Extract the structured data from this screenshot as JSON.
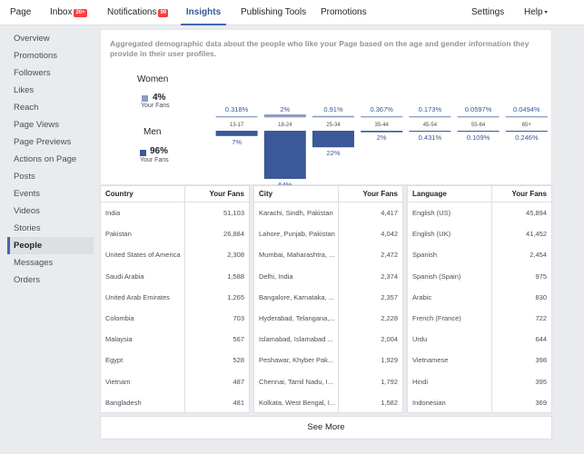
{
  "nav": {
    "items": [
      {
        "label": "Page"
      },
      {
        "label": "Inbox",
        "badge": "20+"
      },
      {
        "label": "Notifications",
        "badge": "99"
      },
      {
        "label": "Insights",
        "active": true
      },
      {
        "label": "Publishing Tools"
      },
      {
        "label": "Promotions"
      }
    ],
    "settings": "Settings",
    "help": "Help",
    "help_caret": "▾"
  },
  "sidebar": {
    "items": [
      {
        "label": "Overview"
      },
      {
        "label": "Promotions"
      },
      {
        "label": "Followers"
      },
      {
        "label": "Likes"
      },
      {
        "label": "Reach"
      },
      {
        "label": "Page Views"
      },
      {
        "label": "Page Previews"
      },
      {
        "label": "Actions on Page"
      },
      {
        "label": "Posts"
      },
      {
        "label": "Events"
      },
      {
        "label": "Videos"
      },
      {
        "label": "Stories"
      },
      {
        "label": "People",
        "active": true
      },
      {
        "label": "Messages"
      },
      {
        "label": "Orders"
      }
    ]
  },
  "demographics": {
    "description": "Aggregated demographic data about the people who like your Page based on the age and gender information they provide in their user profiles.",
    "women": {
      "label": "Women",
      "percent": "4%",
      "sub": "Your Fans",
      "color": "#8b9dc3"
    },
    "men": {
      "label": "Men",
      "percent": "96%",
      "sub": "Your Fans",
      "color": "#3b5998"
    }
  },
  "chart_data": {
    "type": "bar",
    "categories": [
      "13-17",
      "18-24",
      "25-34",
      "35-44",
      "45-54",
      "55-64",
      "65+"
    ],
    "series": [
      {
        "name": "Women",
        "values": [
          0.318,
          2,
          0.91,
          0.367,
          0.173,
          0.0597,
          0.0494
        ],
        "labels": [
          "0.318%",
          "2%",
          "0.91%",
          "0.367%",
          "0.173%",
          "0.0597%",
          "0.0494%"
        ]
      },
      {
        "name": "Men",
        "values": [
          7,
          64,
          22,
          2,
          0.431,
          0.109,
          0.246
        ],
        "labels": [
          "7%",
          "64%",
          "22%",
          "2%",
          "0.431%",
          "0.109%",
          "0.246%"
        ]
      }
    ],
    "title": "",
    "xlabel": "",
    "ylabel": "",
    "women_color": "#8b9dc3",
    "men_color": "#3b5998"
  },
  "tables": [
    {
      "headers": [
        "Country",
        "Your Fans"
      ],
      "rows": [
        [
          "India",
          "51,103"
        ],
        [
          "Pakistan",
          "26,884"
        ],
        [
          "United States of America",
          "2,308"
        ],
        [
          "Saudi Arabia",
          "1,588"
        ],
        [
          "United Arab Emirates",
          "1,265"
        ],
        [
          "Colombia",
          "703"
        ],
        [
          "Malaysia",
          "567"
        ],
        [
          "Egypt",
          "528"
        ],
        [
          "Vietnam",
          "487"
        ],
        [
          "Bangladesh",
          "481"
        ]
      ]
    },
    {
      "headers": [
        "City",
        "Your Fans"
      ],
      "rows": [
        [
          "Karachi, Sindh, Pakistan",
          "4,417"
        ],
        [
          "Lahore, Punjab, Pakistan",
          "4,042"
        ],
        [
          "Mumbai, Maharashtra, ...",
          "2,472"
        ],
        [
          "Delhi, India",
          "2,374"
        ],
        [
          "Bangalore, Karnataka, ...",
          "2,357"
        ],
        [
          "Hyderabad, Telangana,...",
          "2,228"
        ],
        [
          "Islamabad, Islamabad ...",
          "2,004"
        ],
        [
          "Peshawar, Khyber Pak...",
          "1,929"
        ],
        [
          "Chennai, Tamil Nadu, I...",
          "1,792"
        ],
        [
          "Kolkata, West Bengal, I...",
          "1,582"
        ]
      ]
    },
    {
      "headers": [
        "Language",
        "Your Fans"
      ],
      "rows": [
        [
          "English (US)",
          "45,894"
        ],
        [
          "English (UK)",
          "41,452"
        ],
        [
          "Spanish",
          "2,454"
        ],
        [
          "Spanish (Spain)",
          "975"
        ],
        [
          "Arabic",
          "830"
        ],
        [
          "French (France)",
          "722"
        ],
        [
          "Urdu",
          "644"
        ],
        [
          "Vietnamese",
          "398"
        ],
        [
          "Hindi",
          "395"
        ],
        [
          "Indonesian",
          "369"
        ]
      ]
    }
  ],
  "see_more": "See More"
}
